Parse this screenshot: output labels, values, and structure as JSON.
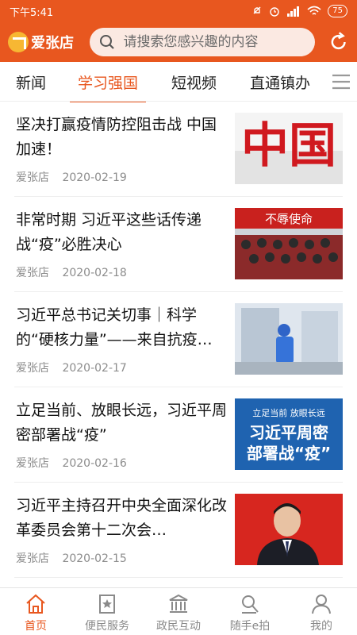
{
  "status": {
    "time": "下午5:41",
    "battery": "75"
  },
  "header": {
    "app_name": "爱张店",
    "search_placeholder": "请搜索您感兴趣的内容"
  },
  "tabs": [
    {
      "label": "新闻"
    },
    {
      "label": "学习强国"
    },
    {
      "label": "短视频"
    },
    {
      "label": "直通镇办"
    }
  ],
  "articles": [
    {
      "title": "坚决打赢疫情防控阻击战 中国加速！",
      "source": "爱张店",
      "date": "2020-02-19",
      "thumb_text": "中国"
    },
    {
      "title": "非常时期 习近平这些话传递战“疫”必胜决心",
      "source": "爱张店",
      "date": "2020-02-18",
      "thumb_text": "不辱使命"
    },
    {
      "title": "习近平总书记关切事｜科学的“硬核力量”——来自抗疫…",
      "source": "爱张店",
      "date": "2020-02-17"
    },
    {
      "title": "立足当前、放眼长远，习近平周密部署战“疫”",
      "source": "爱张店",
      "date": "2020-02-16",
      "thumb_line1": "立足当前 放眼长远",
      "thumb_line2": "习近平周密",
      "thumb_line3": "部署战“疫”"
    },
    {
      "title": "习近平主持召开中央全面深化改革委员会第十二次会…",
      "source": "爱张店",
      "date": "2020-02-15"
    }
  ],
  "tabbar": [
    {
      "label": "首页"
    },
    {
      "label": "便民服务"
    },
    {
      "label": "政民互动"
    },
    {
      "label": "随手e拍"
    },
    {
      "label": "我的"
    }
  ]
}
